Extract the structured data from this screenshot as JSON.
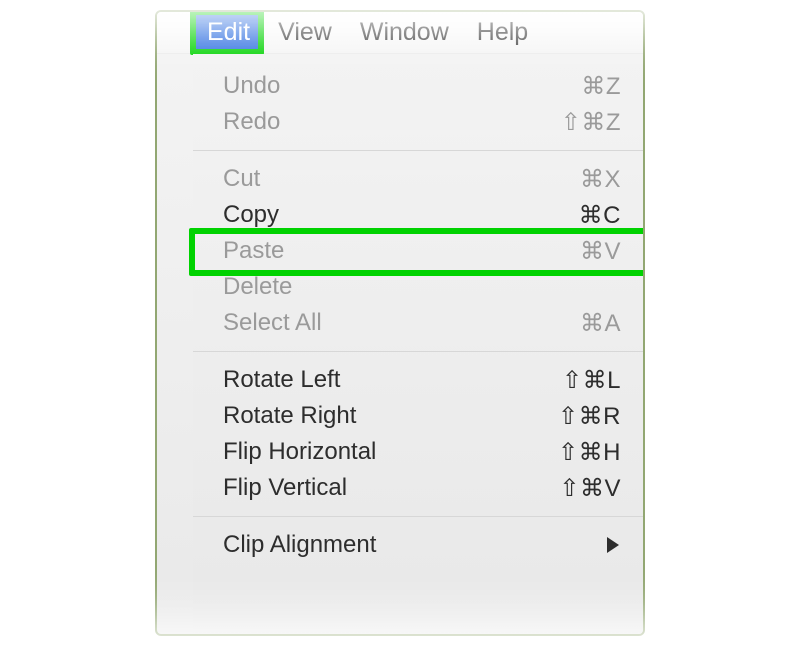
{
  "menubar": {
    "items": [
      {
        "label": "Edit",
        "active": true
      },
      {
        "label": "View",
        "active": false
      },
      {
        "label": "Window",
        "active": false
      },
      {
        "label": "Help",
        "active": false
      }
    ]
  },
  "menu": {
    "sections": [
      [
        {
          "label": "Undo",
          "shortcut": "⌘Z",
          "disabled": true
        },
        {
          "label": "Redo",
          "shortcut": "⇧⌘Z",
          "disabled": true
        }
      ],
      [
        {
          "label": "Cut",
          "shortcut": "⌘X",
          "disabled": true
        },
        {
          "label": "Copy",
          "shortcut": "⌘C",
          "disabled": false,
          "highlight": true
        },
        {
          "label": "Paste",
          "shortcut": "⌘V",
          "disabled": true
        },
        {
          "label": "Delete",
          "shortcut": "",
          "disabled": true
        },
        {
          "label": "Select All",
          "shortcut": "⌘A",
          "disabled": true
        }
      ],
      [
        {
          "label": "Rotate Left",
          "shortcut": "⇧⌘L",
          "disabled": false
        },
        {
          "label": "Rotate Right",
          "shortcut": "⇧⌘R",
          "disabled": false
        },
        {
          "label": "Flip Horizontal",
          "shortcut": "⇧⌘H",
          "disabled": false
        },
        {
          "label": "Flip Vertical",
          "shortcut": "⇧⌘V",
          "disabled": false
        }
      ],
      [
        {
          "label": "Clip Alignment",
          "shortcut": "",
          "disabled": false,
          "submenu": true
        }
      ]
    ]
  },
  "highlight_color": "#00d200"
}
